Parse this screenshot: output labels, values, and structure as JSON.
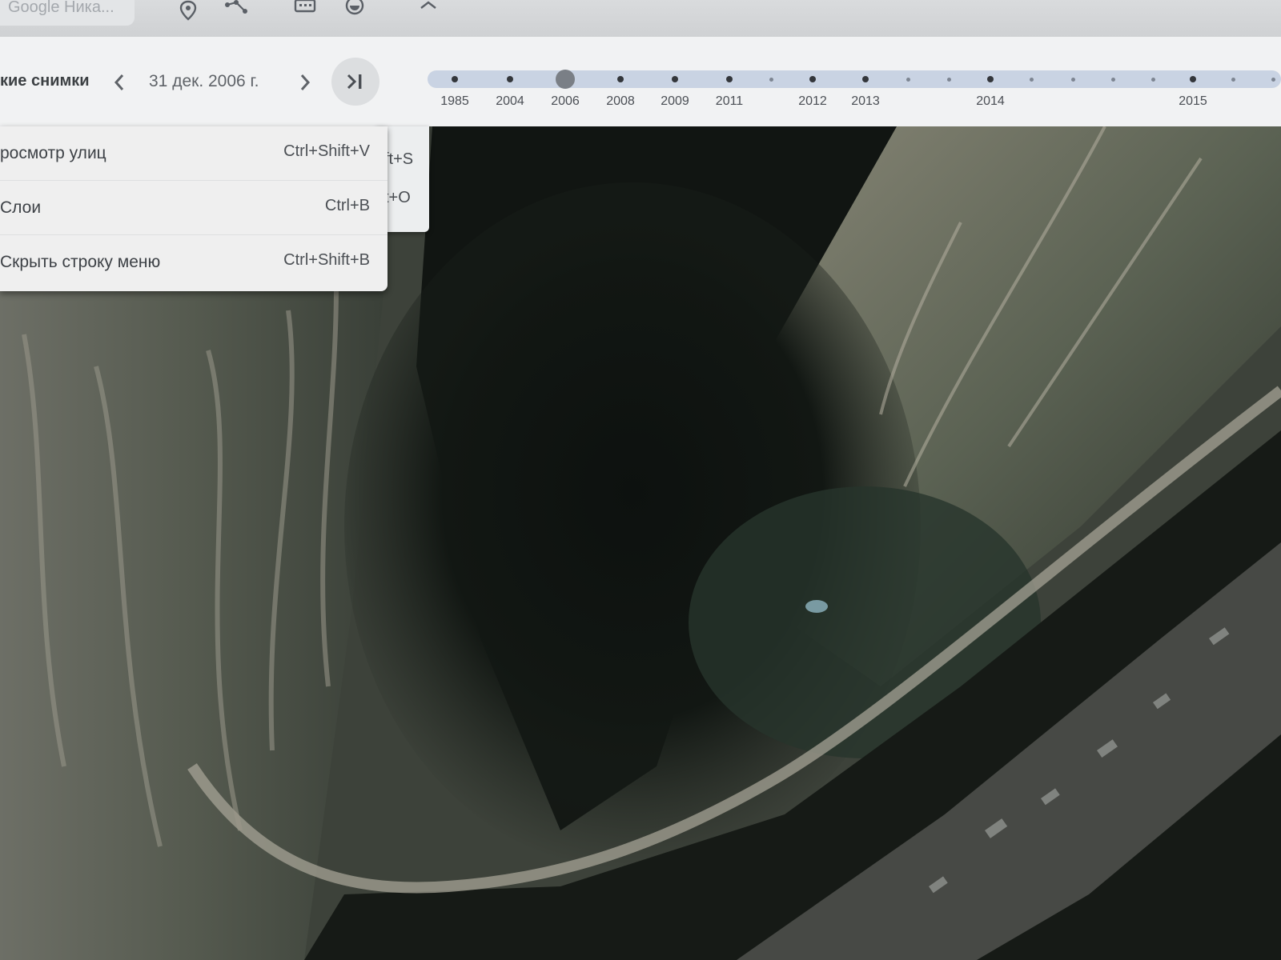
{
  "app": {
    "tab_title": "Google Ника...",
    "toolbar_icons": [
      "placemark-icon",
      "path-icon",
      "historical-imagery-icon",
      "sunlight-icon",
      "close-icon"
    ]
  },
  "history_bar": {
    "title": "кие снимки",
    "current_date": "31 дек. 2006 г.",
    "timeline": {
      "years": [
        "1985",
        "2004",
        "2006",
        "2008",
        "2009",
        "2011",
        "2012",
        "2013",
        "2014",
        "2015"
      ],
      "selected_year": "2006"
    }
  },
  "view_menu": {
    "items": [
      {
        "label": "росмотр улиц",
        "shortcut": "Ctrl+Shift+V"
      },
      {
        "label": "Слои",
        "shortcut": "Ctrl+B"
      },
      {
        "label": "Скрыть строку меню",
        "shortcut": "Ctrl+Shift+B"
      }
    ],
    "behind_partial_shortcuts": [
      "ft+S",
      "t+O"
    ]
  }
}
